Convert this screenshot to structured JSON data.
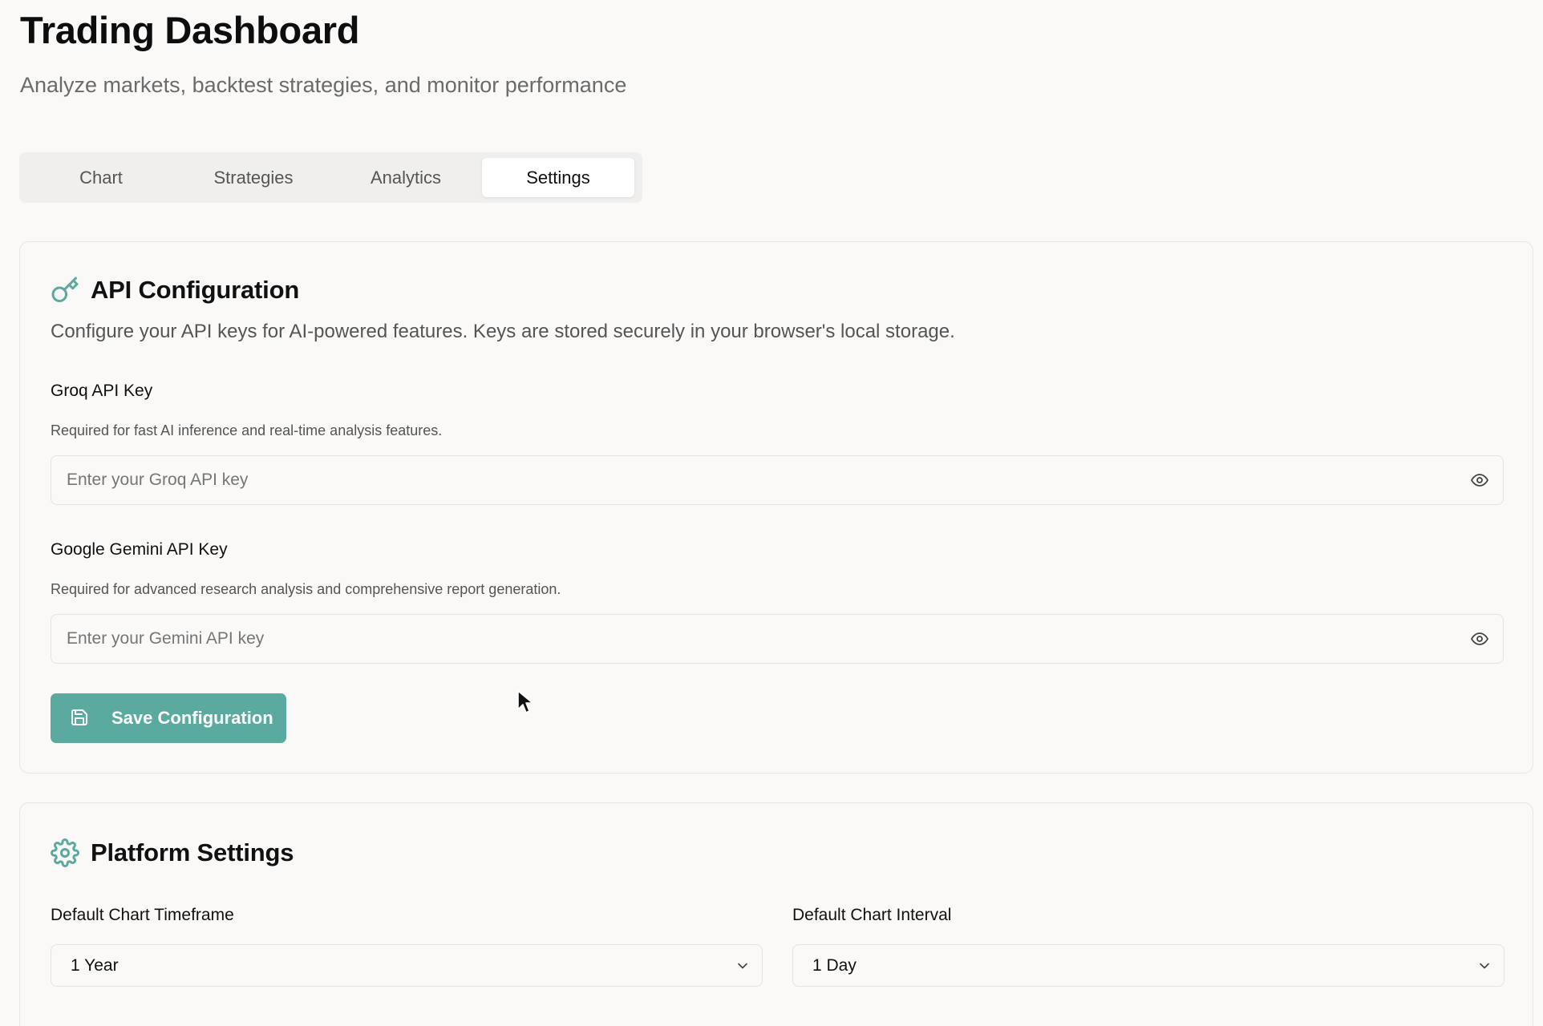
{
  "header": {
    "title": "Trading Dashboard",
    "subtitle": "Analyze markets, backtest strategies, and monitor performance"
  },
  "tabs": [
    {
      "label": "Chart",
      "active": false
    },
    {
      "label": "Strategies",
      "active": false
    },
    {
      "label": "Analytics",
      "active": false
    },
    {
      "label": "Settings",
      "active": true
    }
  ],
  "api_config": {
    "icon": "key-icon",
    "title": "API Configuration",
    "description": "Configure your API keys for AI-powered features. Keys are stored securely in your browser's local storage.",
    "groq": {
      "label": "Groq API Key",
      "help": "Required for fast AI inference and real-time analysis features.",
      "value": "",
      "placeholder": "Enter your Groq API key"
    },
    "gemini": {
      "label": "Google Gemini API Key",
      "help": "Required for advanced research analysis and comprehensive report generation.",
      "value": "",
      "placeholder": "Enter your Gemini API key"
    },
    "save_label": "Save Configuration"
  },
  "platform_settings": {
    "icon": "gear-icon",
    "title": "Platform Settings",
    "timeframe": {
      "label": "Default Chart Timeframe",
      "value": "1 Year"
    },
    "interval": {
      "label": "Default Chart Interval",
      "value": "1 Day"
    }
  },
  "colors": {
    "accent": "#5aaa9f",
    "background": "#faf9f7",
    "border": "#e5e3e0",
    "tab_bar": "#f0efed",
    "muted_text": "#6b6b6b"
  }
}
